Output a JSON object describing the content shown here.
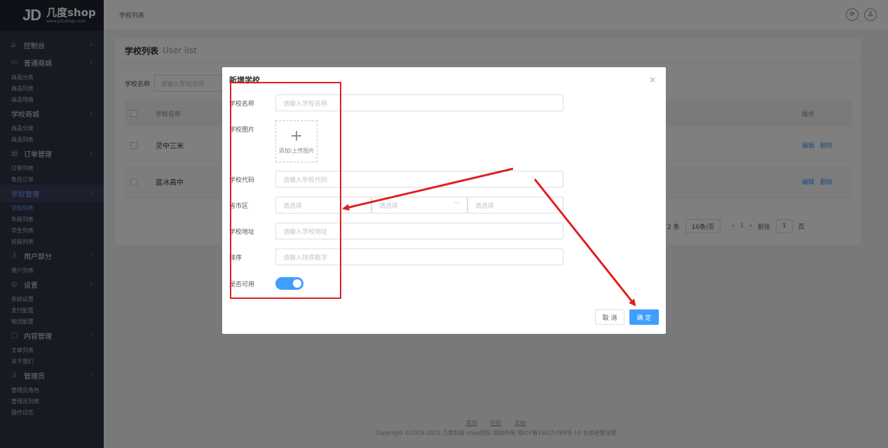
{
  "logo": {
    "mark": "JD",
    "brand": "几度shop",
    "url": "www.jidushop.com"
  },
  "sidebar": {
    "groups": [
      {
        "label": "控制台",
        "icon": "home-icon",
        "subs": []
      },
      {
        "label": "普通商城",
        "icon": "shop-icon",
        "subs": [
          "商品分类",
          "商品列表",
          "商品规格"
        ]
      },
      {
        "label": "学校商城",
        "icon": "",
        "subs": [
          "商品分类",
          "商品列表"
        ]
      },
      {
        "label": "订单管理",
        "icon": "order-icon",
        "subs": [
          "订单列表",
          "售后订单"
        ]
      },
      {
        "label": "学校管理",
        "icon": "",
        "subs": [
          "学校列表",
          "年级列表",
          "学生列表",
          "班级列表"
        ]
      },
      {
        "label": "用户部分",
        "icon": "user-icon",
        "subs": [
          "用户列表"
        ]
      },
      {
        "label": "设置",
        "icon": "settings-icon",
        "subs": [
          "系统设置",
          "支付配置",
          "物流配置"
        ]
      },
      {
        "label": "内容管理",
        "icon": "content-icon",
        "subs": [
          "文章列表",
          "关于我们"
        ]
      },
      {
        "label": "管理员",
        "icon": "admin-icon",
        "subs": [
          "管理员角色",
          "管理员列表",
          "操作日志"
        ]
      }
    ]
  },
  "topbar": {
    "breadcrumb": "学校列表"
  },
  "page": {
    "title": "学校列表",
    "subtitle": "User list",
    "filter_label": "学校名称",
    "filter_placeholder": "请输入学校名称",
    "col_name": "学校名称",
    "col_ops": "操作",
    "rows": [
      {
        "name": "灵中三米",
        "edit": "编辑",
        "del": "删除"
      },
      {
        "name": "蓝冰高中",
        "edit": "编辑",
        "del": "删除"
      }
    ],
    "pager": {
      "total": "2 条",
      "size": "10条/页",
      "page": "1",
      "goto": "前往",
      "goto_val": "1",
      "page_unit": "页"
    }
  },
  "footer": {
    "links": [
      "首页",
      "社区",
      "文档"
    ],
    "copyright": "Copyright ©2019-2022 几度科技-shop团队 版权所有 皖ICP备16015789号-10 主体经营证照"
  },
  "dialog": {
    "title": "新增学校",
    "close": "×",
    "fields": {
      "name_label": "学校名称",
      "name_placeholder": "请输入学校名称",
      "image_label": "学校图片",
      "upload_text": "添加/上传图片",
      "upload_plus": "+",
      "code_label": "学校代码",
      "code_placeholder": "请输入学校代码",
      "region_label": "省市区",
      "region_placeholder": "请选择",
      "address_label": "学校地址",
      "address_placeholder": "请输入学校地址",
      "sort_label": "排序",
      "sort_placeholder": "请输入排序数字",
      "enabled_label": "是否可用",
      "enabled": true
    },
    "cancel": "取 消",
    "ok": "确 定"
  },
  "annotation_color": "#e02020"
}
